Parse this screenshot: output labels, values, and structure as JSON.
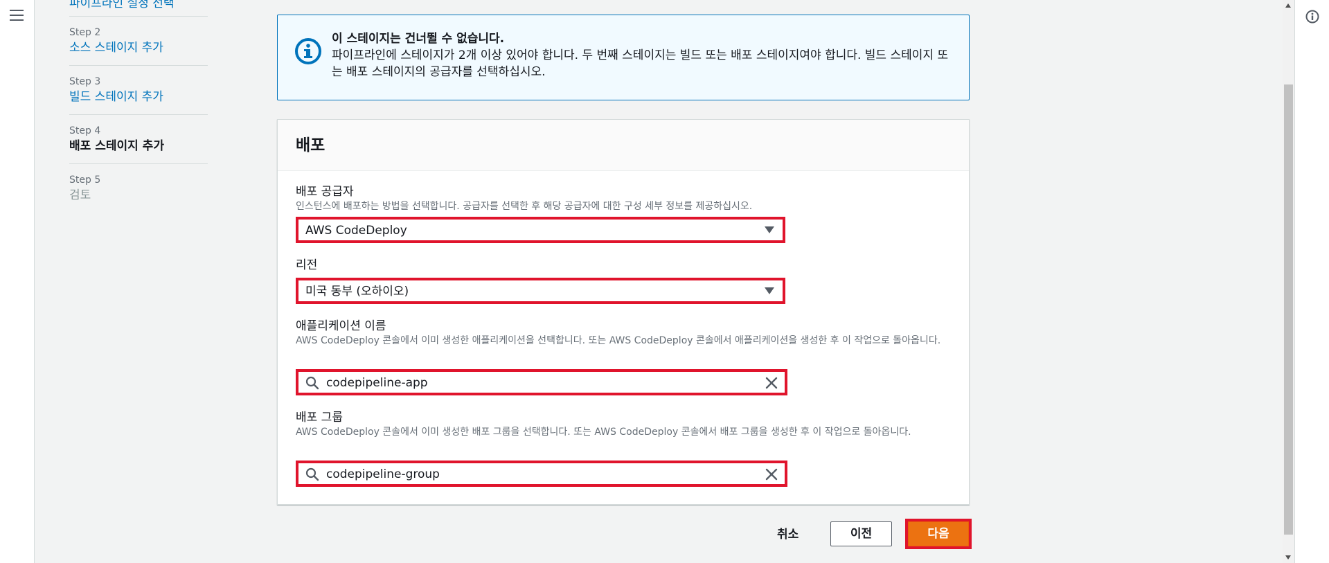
{
  "nav": {
    "step1_link": "파이프라인 설정 선택",
    "steps": [
      {
        "label": "Step 2",
        "title": "소스 스테이지 추가"
      },
      {
        "label": "Step 3",
        "title": "빌드 스테이지 추가"
      },
      {
        "label": "Step 4",
        "title": "배포 스테이지 추가"
      },
      {
        "label": "Step 5",
        "title": "검토"
      }
    ]
  },
  "alert": {
    "title": "이 스테이지는 건너뛸 수 없습니다.",
    "body": "파이프라인에 스테이지가 2개 이상 있어야 합니다. 두 번째 스테이지는 빌드 또는 배포 스테이지여야 합니다. 빌드 스테이지 또는 배포 스테이지의 공급자를 선택하십시오.",
    "icon": "info-icon"
  },
  "panel": {
    "title": "배포",
    "provider": {
      "label": "배포 공급자",
      "desc": "인스턴스에 배포하는 방법을 선택합니다. 공급자를 선택한 후 해당 공급자에 대한 구성 세부 정보를 제공하십시오.",
      "value": "AWS CodeDeploy"
    },
    "region": {
      "label": "리전",
      "value": "미국 동부 (오하이오)"
    },
    "app_name": {
      "label": "애플리케이션 이름",
      "desc": "AWS CodeDeploy 콘솔에서 이미 생성한 애플리케이션을 선택합니다. 또는 AWS CodeDeploy 콘솔에서 애플리케이션을 생성한 후 이 작업으로 돌아옵니다.",
      "value": "codepipeline-app"
    },
    "deploy_group": {
      "label": "배포 그룹",
      "desc": "AWS CodeDeploy 콘솔에서 이미 생성한 배포 그룹을 선택합니다. 또는 AWS CodeDeploy 콘솔에서 배포 그룹을 생성한 후 이 작업으로 돌아옵니다.",
      "value": "codepipeline-group"
    }
  },
  "actions": {
    "cancel": "취소",
    "previous": "이전",
    "next": "다음"
  },
  "colors": {
    "accent": "#0073bb",
    "primary_button": "#ec7211",
    "highlight": "#e0142c"
  }
}
